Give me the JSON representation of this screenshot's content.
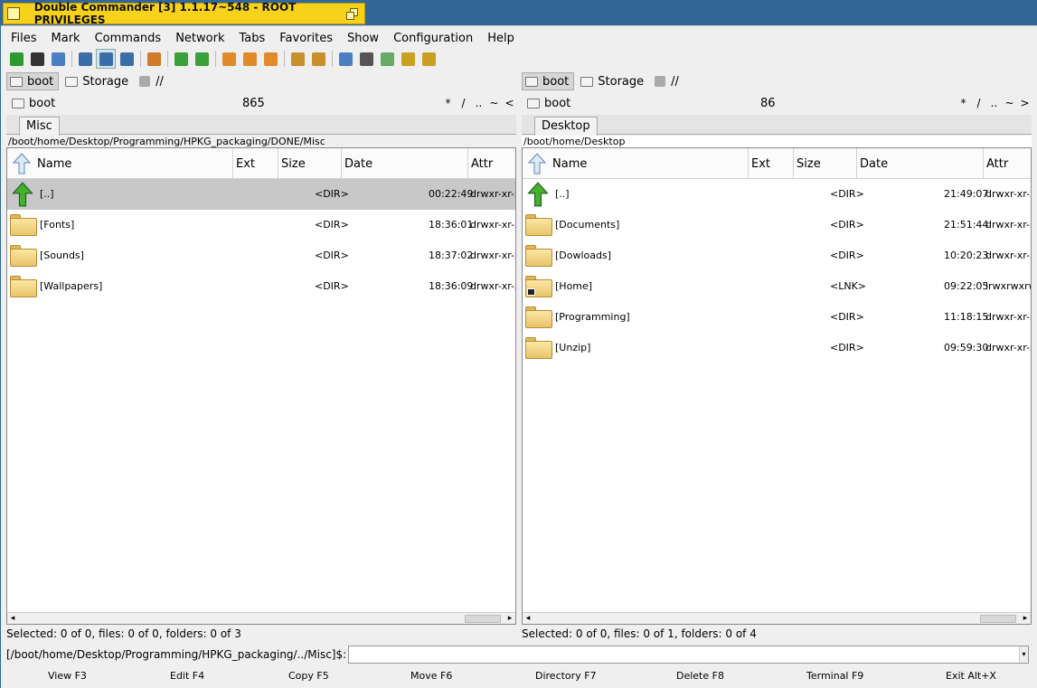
{
  "window": {
    "title": "Double Commander [3] 1.1.17~548 - ROOT PRIVILEGES"
  },
  "menu": [
    "Files",
    "Mark",
    "Commands",
    "Network",
    "Tabs",
    "Favorites",
    "Show",
    "Configuration",
    "Help"
  ],
  "toolbar_icons": [
    "refresh-icon",
    "terminal-icon",
    "options-icon",
    "brief-view-icon",
    "full-view-icon",
    "thumbnails-view-icon",
    "compare-directories-icon",
    "copy-to-left-icon",
    "copy-to-right-icon",
    "multi-rename-icon",
    "delete-icon",
    "cut-icon",
    "pack-files-icon",
    "extract-files-icon",
    "sync-dirs-icon",
    "search-icon",
    "edit-icon",
    "hotlist-icon",
    "copy-names-icon"
  ],
  "left": {
    "drives": [
      {
        "label": "boot",
        "active": true
      },
      {
        "label": "Storage",
        "active": false
      },
      {
        "label": "//",
        "active": false
      }
    ],
    "drive_name": "boot",
    "free_space": "865",
    "hot_paths": [
      "*",
      "/",
      "..",
      "~",
      "<"
    ],
    "tab": "Misc",
    "path": "/boot/home/Desktop/Programming/HPKG_packaging/DONE/Misc",
    "columns": {
      "name": "Name",
      "ext": "Ext",
      "size": "Size",
      "date": "Date",
      "attr": "Attr"
    },
    "rows": [
      {
        "name": "[..]",
        "size": "<DIR>",
        "date": "00:22:49",
        "attr": "drwxr-xr-x",
        "kind": "up"
      },
      {
        "name": "[Fonts]",
        "size": "<DIR>",
        "date": "18:36:01",
        "attr": "drwxr-xr-x",
        "kind": "folder"
      },
      {
        "name": "[Sounds]",
        "size": "<DIR>",
        "date": "18:37:02",
        "attr": "drwxr-xr-x",
        "kind": "folder"
      },
      {
        "name": "[Wallpapers]",
        "size": "<DIR>",
        "date": "18:36:09",
        "attr": "drwxr-xr-x",
        "kind": "folder"
      }
    ],
    "status": "Selected: 0 of 0, files: 0 of 0, folders: 0 of 3"
  },
  "right": {
    "drives": [
      {
        "label": "boot",
        "active": true
      },
      {
        "label": "Storage",
        "active": false
      },
      {
        "label": "//",
        "active": false
      }
    ],
    "drive_name": "boot",
    "free_space": "86",
    "hot_paths": [
      "*",
      "/",
      "..",
      "~",
      ">"
    ],
    "tab": "Desktop",
    "path": "/boot/home/Desktop",
    "columns": {
      "name": "Name",
      "ext": "Ext",
      "size": "Size",
      "date": "Date",
      "attr": "Attr"
    },
    "rows": [
      {
        "name": "[..]",
        "size": "<DIR>",
        "date": "21:49:07",
        "attr": "drwxr-xr-x",
        "kind": "up"
      },
      {
        "name": "[Documents]",
        "size": "<DIR>",
        "date": "21:51:44",
        "attr": "drwxr-xr-x",
        "kind": "folder"
      },
      {
        "name": "[Dowloads]",
        "size": "<DIR>",
        "date": "10:20:23",
        "attr": "drwxr-xr-x",
        "kind": "folder"
      },
      {
        "name": "[Home]",
        "size": "<LNK>",
        "date": "09:22:05",
        "attr": "lrwxrwxrw",
        "kind": "link"
      },
      {
        "name": "[Programming]",
        "size": "<DIR>",
        "date": "11:18:15",
        "attr": "drwxr-xr-x",
        "kind": "folder"
      },
      {
        "name": "[Unzip]",
        "size": "<DIR>",
        "date": "09:59:30",
        "attr": "drwxr-xr-x",
        "kind": "folder"
      }
    ],
    "status": "Selected: 0 of 0, files: 0 of 1, folders: 0 of 4"
  },
  "command_line": {
    "prompt": "[/boot/home/Desktop/Programming/HPKG_packaging/../Misc]$:",
    "value": ""
  },
  "function_keys": [
    "View F3",
    "Edit F4",
    "Copy F5",
    "Move F6",
    "Directory F7",
    "Delete F8",
    "Terminal F9",
    "Exit Alt+X"
  ]
}
